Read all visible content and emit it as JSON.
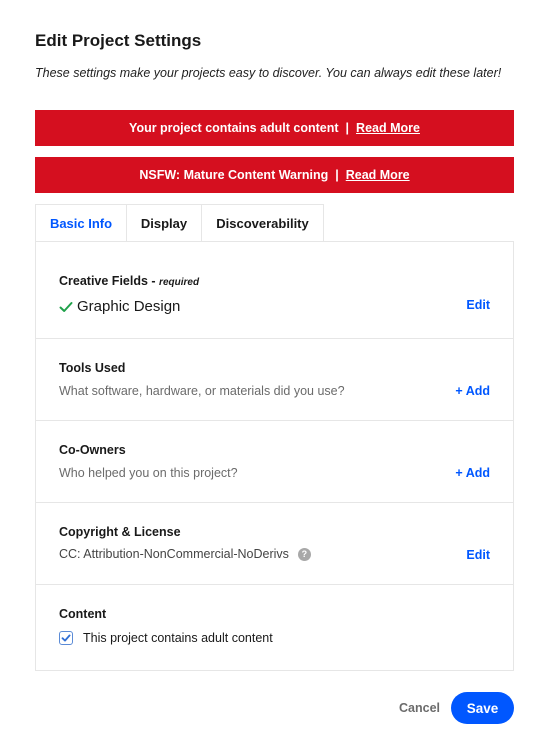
{
  "dialog": {
    "title": "Edit Project Settings",
    "subtitle": "These settings make your projects easy to discover. You can always edit these later!"
  },
  "banners": [
    {
      "text": "Your project contains adult content",
      "separator": "|",
      "link": "Read More"
    },
    {
      "text": "NSFW: Mature Content Warning",
      "separator": "|",
      "link": "Read More"
    }
  ],
  "tabs": [
    {
      "label": "Basic Info",
      "active": true
    },
    {
      "label": "Display",
      "active": false
    },
    {
      "label": "Discoverability",
      "active": false
    }
  ],
  "sections": {
    "creative_fields": {
      "label": "Creative Fields",
      "required_prefix": " - ",
      "required": "required",
      "value": "Graphic Design",
      "action": "Edit"
    },
    "tools_used": {
      "label": "Tools Used",
      "hint": "What software, hardware, or materials did you use?",
      "action": "+ Add"
    },
    "co_owners": {
      "label": "Co-Owners",
      "hint": "Who helped you on this project?",
      "action": "+ Add"
    },
    "copyright": {
      "label": "Copyright & License",
      "value": "CC: Attribution-NonCommercial-NoDerivs",
      "help_glyph": "?",
      "action": "Edit"
    },
    "content": {
      "label": "Content",
      "checkbox_label": "This project contains adult content",
      "checked": true
    }
  },
  "footer": {
    "cancel": "Cancel",
    "save": "Save"
  },
  "colors": {
    "accent": "#0057ff",
    "banner": "#d50f1f",
    "check": "#1fa14a"
  },
  "icons": [
    "checkmark-icon",
    "help-icon",
    "checkbox-check-icon"
  ]
}
